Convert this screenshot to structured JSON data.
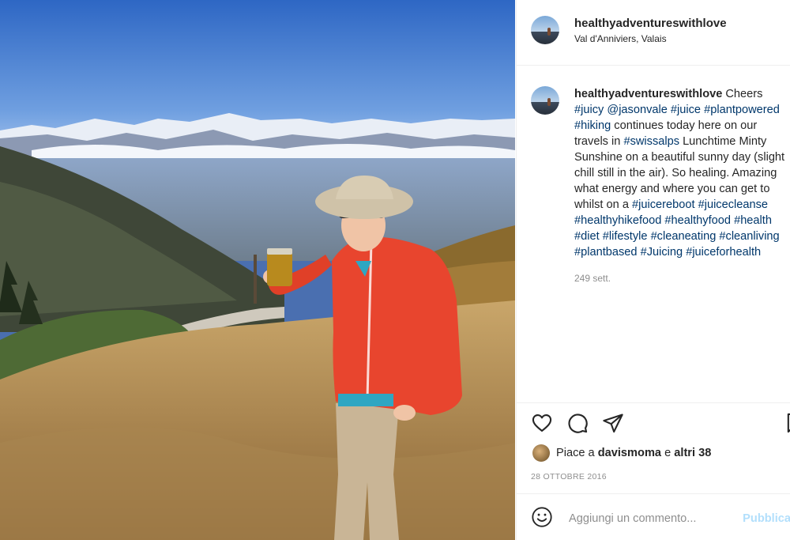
{
  "post": {
    "username": "healthyadventureswithlove",
    "location": "Val d'Anniviers, Valais",
    "caption_segments": [
      {
        "text": "Cheers ",
        "tag": false
      },
      {
        "text": "#juicy",
        "tag": true
      },
      {
        "text": " ",
        "tag": false
      },
      {
        "text": "@jasonvale",
        "tag": true
      },
      {
        "text": " ",
        "tag": false
      },
      {
        "text": "#juice",
        "tag": true
      },
      {
        "text": " ",
        "tag": false
      },
      {
        "text": "#plantpowered",
        "tag": true
      },
      {
        "text": " ",
        "tag": false
      },
      {
        "text": "#hiking",
        "tag": true
      },
      {
        "text": " continues today here on our travels in ",
        "tag": false
      },
      {
        "text": "#swissalps",
        "tag": true
      },
      {
        "text": " Lunchtime Minty Sunshine on a beautiful sunny day (slight chill still in the air). So healing. Amazing what energy and where you can get to whilst on a ",
        "tag": false
      },
      {
        "text": "#juicereboot",
        "tag": true
      },
      {
        "text": " ",
        "tag": false
      },
      {
        "text": "#juicecleanse",
        "tag": true
      },
      {
        "text": " ",
        "tag": false
      },
      {
        "text": "#healthyhikefood",
        "tag": true
      },
      {
        "text": " ",
        "tag": false
      },
      {
        "text": "#healthyfood",
        "tag": true
      },
      {
        "text": " ",
        "tag": false
      },
      {
        "text": "#health",
        "tag": true
      },
      {
        "text": " ",
        "tag": false
      },
      {
        "text": "#diet",
        "tag": true
      },
      {
        "text": " ",
        "tag": false
      },
      {
        "text": "#lifestyle",
        "tag": true
      },
      {
        "text": " ",
        "tag": false
      },
      {
        "text": "#cleaneating",
        "tag": true
      },
      {
        "text": " ",
        "tag": false
      },
      {
        "text": "#cleanliving",
        "tag": true
      },
      {
        "text": " ",
        "tag": false
      },
      {
        "text": "#plantbased",
        "tag": true
      },
      {
        "text": " ",
        "tag": false
      },
      {
        "text": "#Juicing",
        "tag": true
      },
      {
        "text": " ",
        "tag": false
      },
      {
        "text": "#juiceforhealth",
        "tag": true
      }
    ],
    "time_ago": "249 sett.",
    "likes": {
      "prefix": "Piace a ",
      "user": "davismoma",
      "middle": " e ",
      "others": "altri 38"
    },
    "date": "28 OTTOBRE 2016",
    "comment_placeholder": "Aggiungi un commento...",
    "publish_label": "Pubblica"
  },
  "icons": {
    "like": "heart-icon",
    "comment": "comment-bubble-icon",
    "share": "paper-plane-icon",
    "save": "bookmark-icon",
    "emoji": "smiley-icon"
  },
  "colors": {
    "hashtag": "#00376b",
    "text": "#262626",
    "muted": "#8e8e8e",
    "publish": "#b2dffc",
    "jacket": "#e8452e"
  }
}
